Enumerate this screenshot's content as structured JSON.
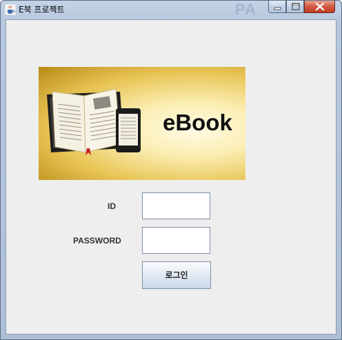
{
  "window": {
    "title": "E북 프로젝트",
    "bg_ghost_text": "PA"
  },
  "banner": {
    "text": "eBook"
  },
  "form": {
    "id_label": "ID",
    "password_label": "PASSWORD",
    "id_value": "",
    "password_value": "",
    "login_label": "로그인"
  },
  "colors": {
    "client_bg": "#eeeeee",
    "close_button": "#c8432c",
    "banner_gold": "#e8c455"
  },
  "icons": {
    "app": "java-coffee-icon",
    "minimize": "minimize-icon",
    "maximize": "maximize-icon",
    "close": "close-icon"
  }
}
